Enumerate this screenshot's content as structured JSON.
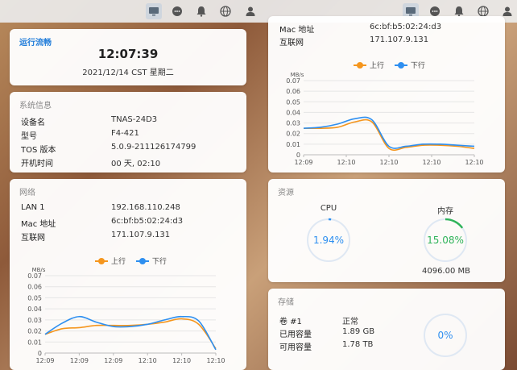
{
  "taskbar": {
    "icons": [
      "monitor-icon",
      "chat-icon",
      "bell-icon",
      "globe-icon",
      "user-icon"
    ]
  },
  "runtime": {
    "title": "运行流畅",
    "time": "12:07:39",
    "date": "2021/12/14 CST 星期二"
  },
  "system": {
    "title": "系统信息",
    "rows": [
      {
        "k": "设备名",
        "v": "TNAS-24D3"
      },
      {
        "k": "型号",
        "v": "F4-421"
      },
      {
        "k": "TOS 版本",
        "v": "5.0.9-211126174799"
      },
      {
        "k": "开机时间",
        "v": "00 天, 02:10"
      }
    ]
  },
  "network": {
    "title": "网络",
    "rows": [
      {
        "k": "LAN 1",
        "v": "192.168.110.248"
      },
      {
        "k": "Mac 地址",
        "v": "6c:bf:b5:02:24:d3"
      },
      {
        "k": "互联网",
        "v": "171.107.9.131"
      }
    ],
    "legend_up": "上行",
    "legend_down": "下行"
  },
  "network_right": {
    "rows": [
      {
        "k": "Mac 地址",
        "v": "6c:bf:b5:02:24:d3"
      },
      {
        "k": "互联网",
        "v": "171.107.9.131"
      }
    ],
    "legend_up": "上行",
    "legend_down": "下行"
  },
  "resources": {
    "title": "资源",
    "cpu_label": "CPU",
    "cpu_value": "1.94%",
    "cpu_fraction": 0.0194,
    "mem_label": "内存",
    "mem_value": "15.08%",
    "mem_fraction": 0.1508,
    "mem_total": "4096.00 MB"
  },
  "storage": {
    "title": "存储",
    "rows": [
      {
        "k": "卷 #1",
        "v": "正常"
      },
      {
        "k": "已用容量",
        "v": "1.89 GB"
      },
      {
        "k": "可用容量",
        "v": "1.78 TB"
      }
    ],
    "usage_value": "0%",
    "usage_fraction": 0
  },
  "colors": {
    "up": "#f5961e",
    "down": "#2e8ff0",
    "accent": "#1e7bd9",
    "mem_ring": "#2fb35a"
  },
  "chart_data": [
    {
      "type": "line",
      "ylabel": "MB/s",
      "ylim": [
        0,
        0.07
      ],
      "yticks": [
        "0",
        "0.01",
        "0.02",
        "0.03",
        "0.04",
        "0.05",
        "0.06",
        "0.07"
      ],
      "x": [
        0,
        1,
        2,
        3,
        4,
        5,
        6,
        7,
        8,
        9,
        10
      ],
      "xticks": [
        "12:09",
        "12:09",
        "12:09",
        "12:10",
        "12:10",
        "12:10"
      ],
      "series": [
        {
          "name": "上行",
          "values": [
            0.017,
            0.022,
            0.023,
            0.025,
            0.025,
            0.025,
            0.026,
            0.028,
            0.031,
            0.026,
            0.004
          ]
        },
        {
          "name": "下行",
          "values": [
            0.017,
            0.027,
            0.033,
            0.028,
            0.024,
            0.024,
            0.026,
            0.03,
            0.033,
            0.029,
            0.003
          ]
        }
      ]
    },
    {
      "type": "line",
      "ylabel": "MB/s",
      "ylim": [
        0,
        0.07
      ],
      "yticks": [
        "0",
        "0.01",
        "0.02",
        "0.03",
        "0.04",
        "0.05",
        "0.06",
        "0.07"
      ],
      "x": [
        0,
        1,
        2,
        3,
        4,
        5,
        6,
        7,
        8,
        9,
        10
      ],
      "xticks": [
        "12:09",
        "12:10",
        "12:10",
        "12:10",
        "12:10"
      ],
      "series": [
        {
          "name": "上行",
          "values": [
            0.025,
            0.025,
            0.026,
            0.031,
            0.031,
            0.006,
            0.007,
            0.009,
            0.009,
            0.008,
            0.006
          ]
        },
        {
          "name": "下行",
          "values": [
            0.025,
            0.026,
            0.029,
            0.034,
            0.033,
            0.008,
            0.008,
            0.01,
            0.01,
            0.009,
            0.008
          ]
        }
      ]
    }
  ]
}
